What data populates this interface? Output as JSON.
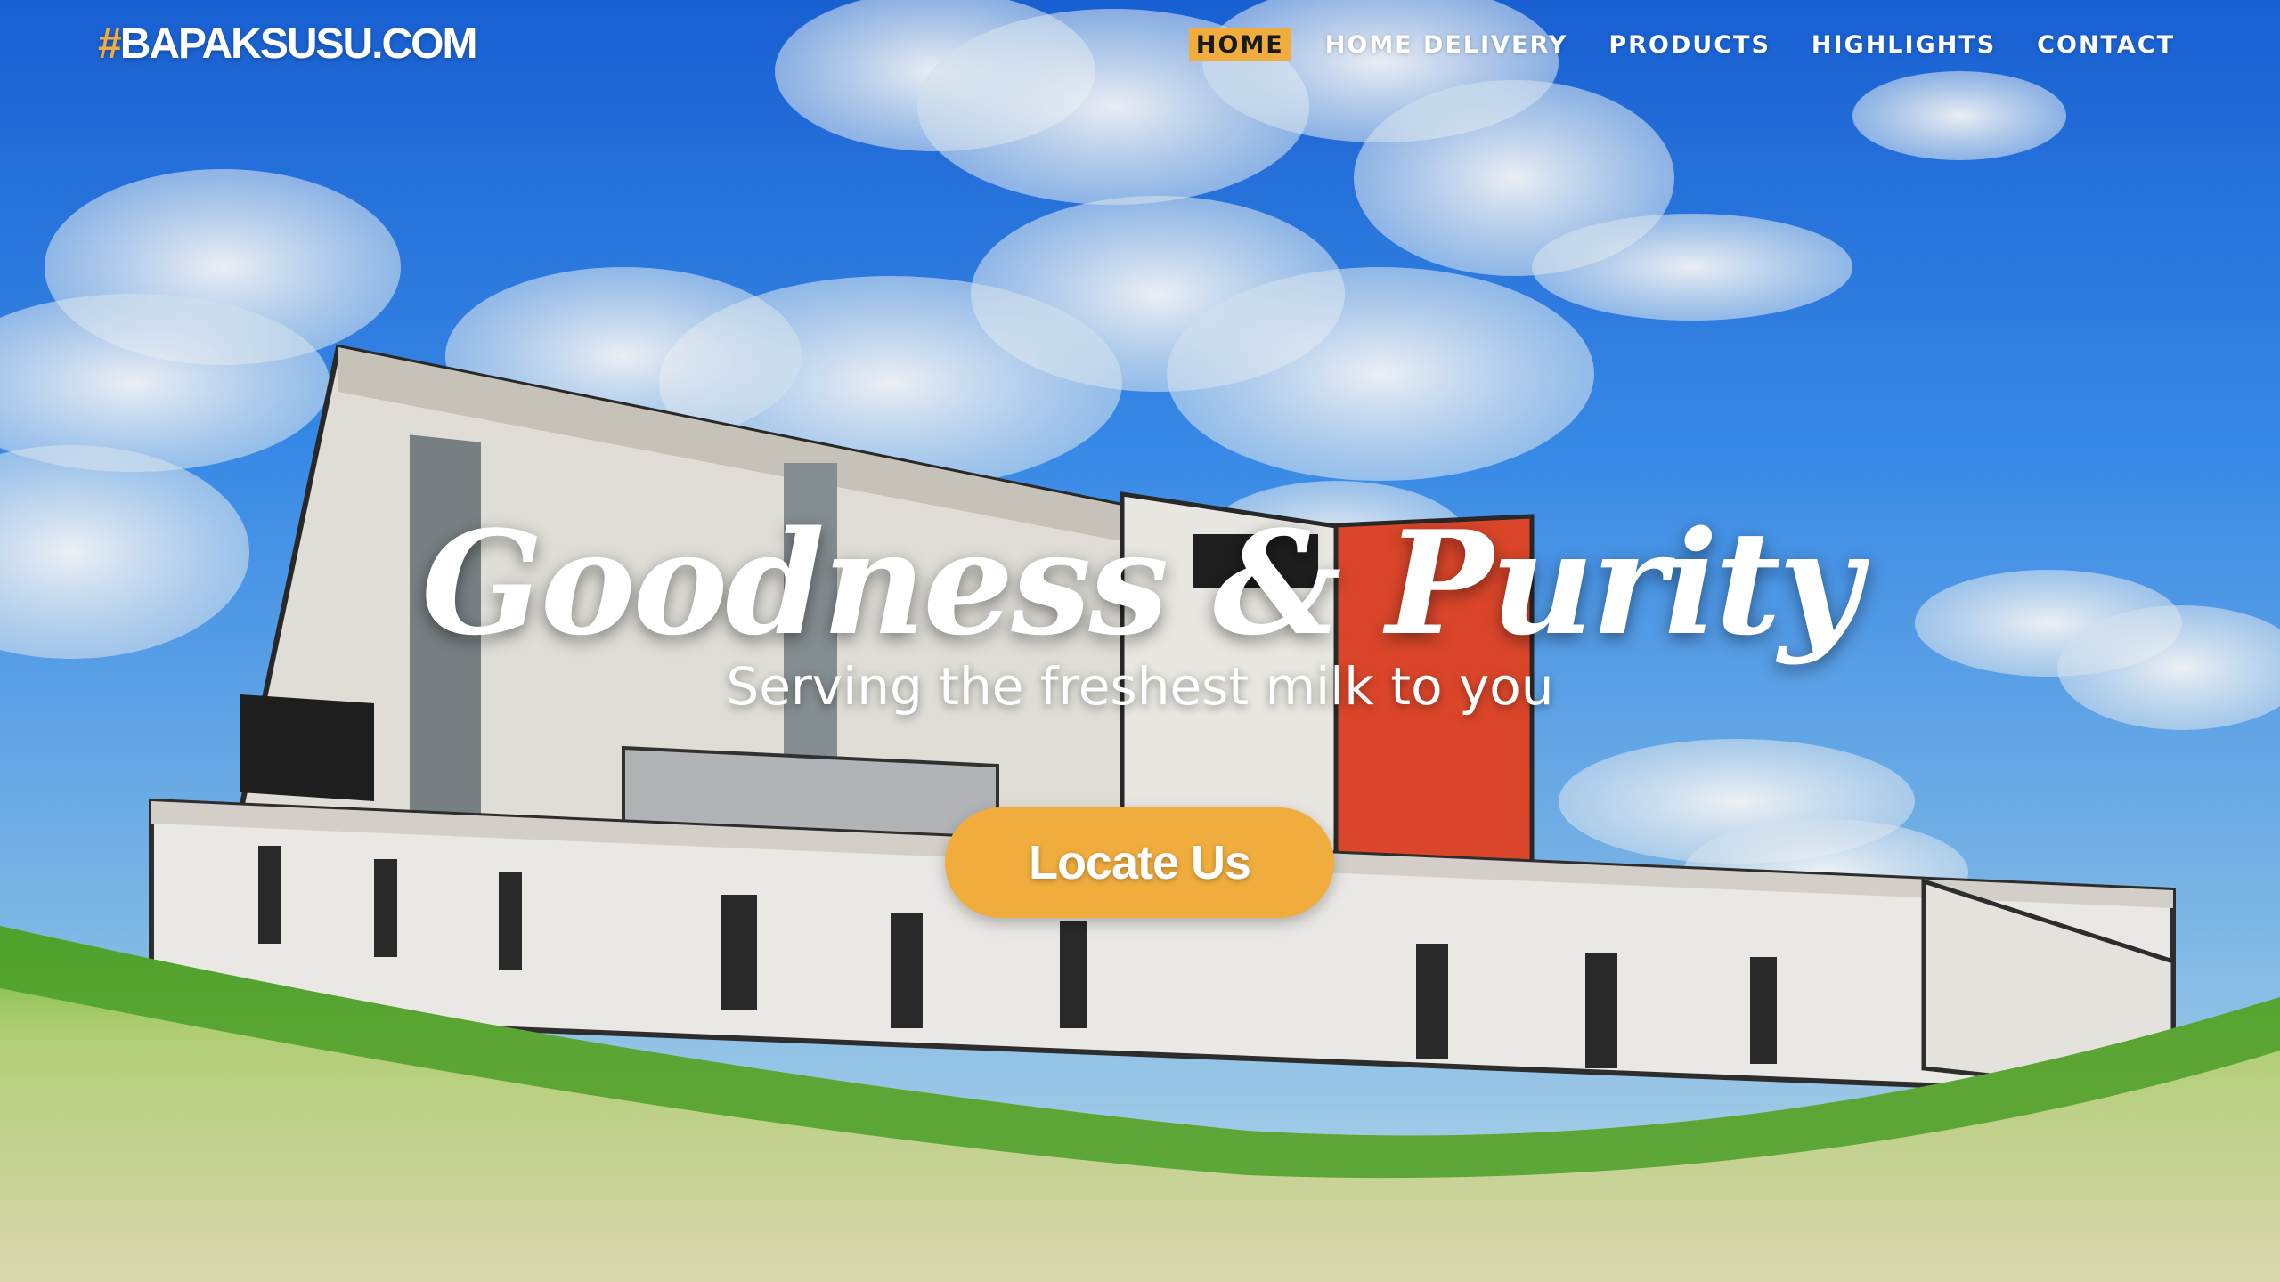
{
  "brand": {
    "hash": "#",
    "name": "BAPAKSUSU.COM"
  },
  "nav": {
    "items": [
      {
        "label": "HOME",
        "active": true
      },
      {
        "label": "HOME DELIVERY",
        "active": false
      },
      {
        "label": "PRODUCTS",
        "active": false
      },
      {
        "label": "HIGHLIGHTS",
        "active": false
      },
      {
        "label": "CONTACT",
        "active": false
      }
    ]
  },
  "hero": {
    "title": "Goodness & Purity",
    "subtitle": "Serving the freshest milk to you",
    "cta_label": "Locate Us"
  },
  "colors": {
    "accent": "#f0ad3e",
    "sky": "#2a7de6",
    "text": "#ffffff"
  }
}
